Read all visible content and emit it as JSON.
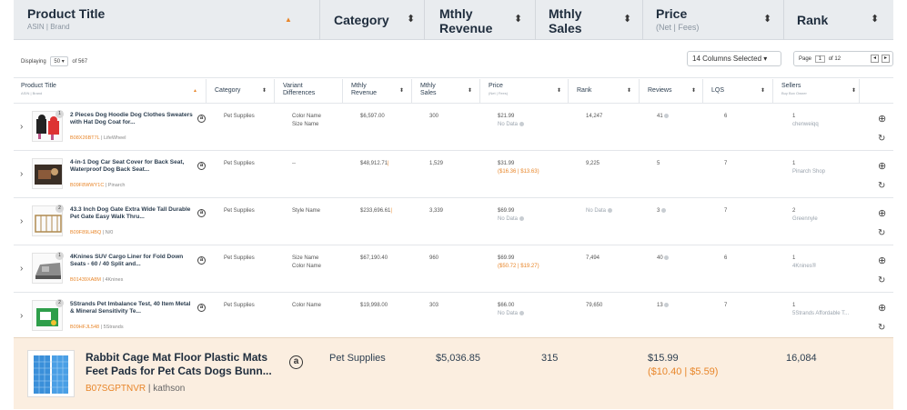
{
  "header": {
    "product_title": "Product Title",
    "product_sub": "ASIN | Brand",
    "category": "Category",
    "mthly_revenue_1": "Mthly",
    "mthly_revenue_2": "Revenue",
    "mthly_sales_1": "Mthly",
    "mthly_sales_2": "Sales",
    "price": "Price",
    "price_sub": "(Net | Fees)",
    "rank": "Rank",
    "sort_active": "▲",
    "sort_icon": "⬍"
  },
  "display_bar": {
    "displaying": "Displaying",
    "per_page": "50 ▾",
    "of_total": "of 567",
    "columns_selected": "14 Columns Selected ▾",
    "page_label": "Page",
    "page_value": "1",
    "page_of": "of 12",
    "prev": "◂",
    "next": "▸"
  },
  "columns": {
    "product_title": "Product Title",
    "product_sub": "ASIN | Brand",
    "category": "Category",
    "variant_1": "Variant",
    "variant_2": "Differences",
    "revenue_1": "Mthly",
    "revenue_2": "Revenue",
    "sales_1": "Mthly",
    "sales_2": "Sales",
    "price": "Price",
    "price_sub": "(Net | Fees)",
    "rank": "Rank",
    "reviews": "Reviews",
    "lqs": "LQS",
    "sellers": "Sellers",
    "sellers_sub": "Buy Box Owner"
  },
  "rows": [
    {
      "badge": "1",
      "title": "2 Pieces Dog Hoodie Dog Clothes Sweaters with Hat Dog Coat for...",
      "asin": "B08X26BT7L",
      "brand": "| LifeWheel",
      "category": "Pet Supplies",
      "variant_1": "Color Name",
      "variant_2": "Size Name",
      "revenue": "$6,597.00",
      "sales": "300",
      "price": "$21.99",
      "price_sub": "No Data",
      "rank": "14,247",
      "reviews": "41",
      "lqs": "6",
      "sellers": "1",
      "seller_name": "chenweiqq"
    },
    {
      "badge": "",
      "title": "4-in-1 Dog Car Seat Cover for Back Seat, Waterproof Dog Back Seat...",
      "asin": "B09F8WWY1C",
      "brand": "| Pinarch",
      "category": "Pet Supplies",
      "variant_1": "--",
      "variant_2": "",
      "revenue": "$48,912.71",
      "sales": "1,529",
      "price": "$31.99",
      "price_sub": "($16.36 | $13.63)",
      "rank": "9,225",
      "reviews": "5",
      "lqs": "7",
      "sellers": "1",
      "seller_name": "Pinarch Shop"
    },
    {
      "badge": "2",
      "title": "43.3 Inch Dog Gate Extra Wide Tall Durable Pet Gate Easy Walk Thru...",
      "asin": "B09F89LHBQ",
      "brand": "| N/0",
      "category": "Pet Supplies",
      "variant_1": "Style Name",
      "variant_2": "",
      "revenue": "$233,696.61",
      "sales": "3,339",
      "price": "$69.99",
      "price_sub": "No Data",
      "rank": "No Data",
      "reviews": "3",
      "lqs": "7",
      "sellers": "2",
      "seller_name": "Greennyle"
    },
    {
      "badge": "1",
      "title": "4Knines SUV Cargo Liner for Fold Down Seats - 60 / 40 Split and...",
      "asin": "B01439XA8M",
      "brand": "| 4Knines",
      "category": "Pet Supplies",
      "variant_1": "Size Name",
      "variant_2": "Color Name",
      "revenue": "$67,190.40",
      "sales": "960",
      "price": "$69.99",
      "price_sub": "($50.72 | $19.27)",
      "rank": "7,494",
      "reviews": "40",
      "lqs": "6",
      "sellers": "1",
      "seller_name": "4Knines®"
    },
    {
      "badge": "2",
      "title": "5Strands Pet Imbalance Test, 40 Item Metal & Mineral Sensitivity Te...",
      "asin": "B09HFJL548",
      "brand": "| 5Strands",
      "category": "Pet Supplies",
      "variant_1": "Color Name",
      "variant_2": "",
      "revenue": "$19,998.00",
      "sales": "303",
      "price": "$66.00",
      "price_sub": "No Data",
      "rank": "79,650",
      "reviews": "13",
      "lqs": "7",
      "sellers": "1",
      "seller_name": "5Strands Affordable T..."
    }
  ],
  "highlight": {
    "title": "Rabbit Cage Mat Floor Plastic Mats Feet Pads for Pet Cats Dogs Bunn...",
    "asin": "B07SGPTNVR",
    "brand": "| kathson",
    "category": "Pet Supplies",
    "revenue": "$5,036.85",
    "sales": "315",
    "price": "$15.99",
    "price_sub": "($10.40 | $5.59)",
    "rank": "16,084"
  },
  "icons": {
    "amazon": "a",
    "expand": "›",
    "add": "⊕",
    "refresh": "↻"
  },
  "colors": {
    "accent": "#e8862a",
    "header_bg": "#e9ecef",
    "highlight_bg": "#fbeee0"
  }
}
